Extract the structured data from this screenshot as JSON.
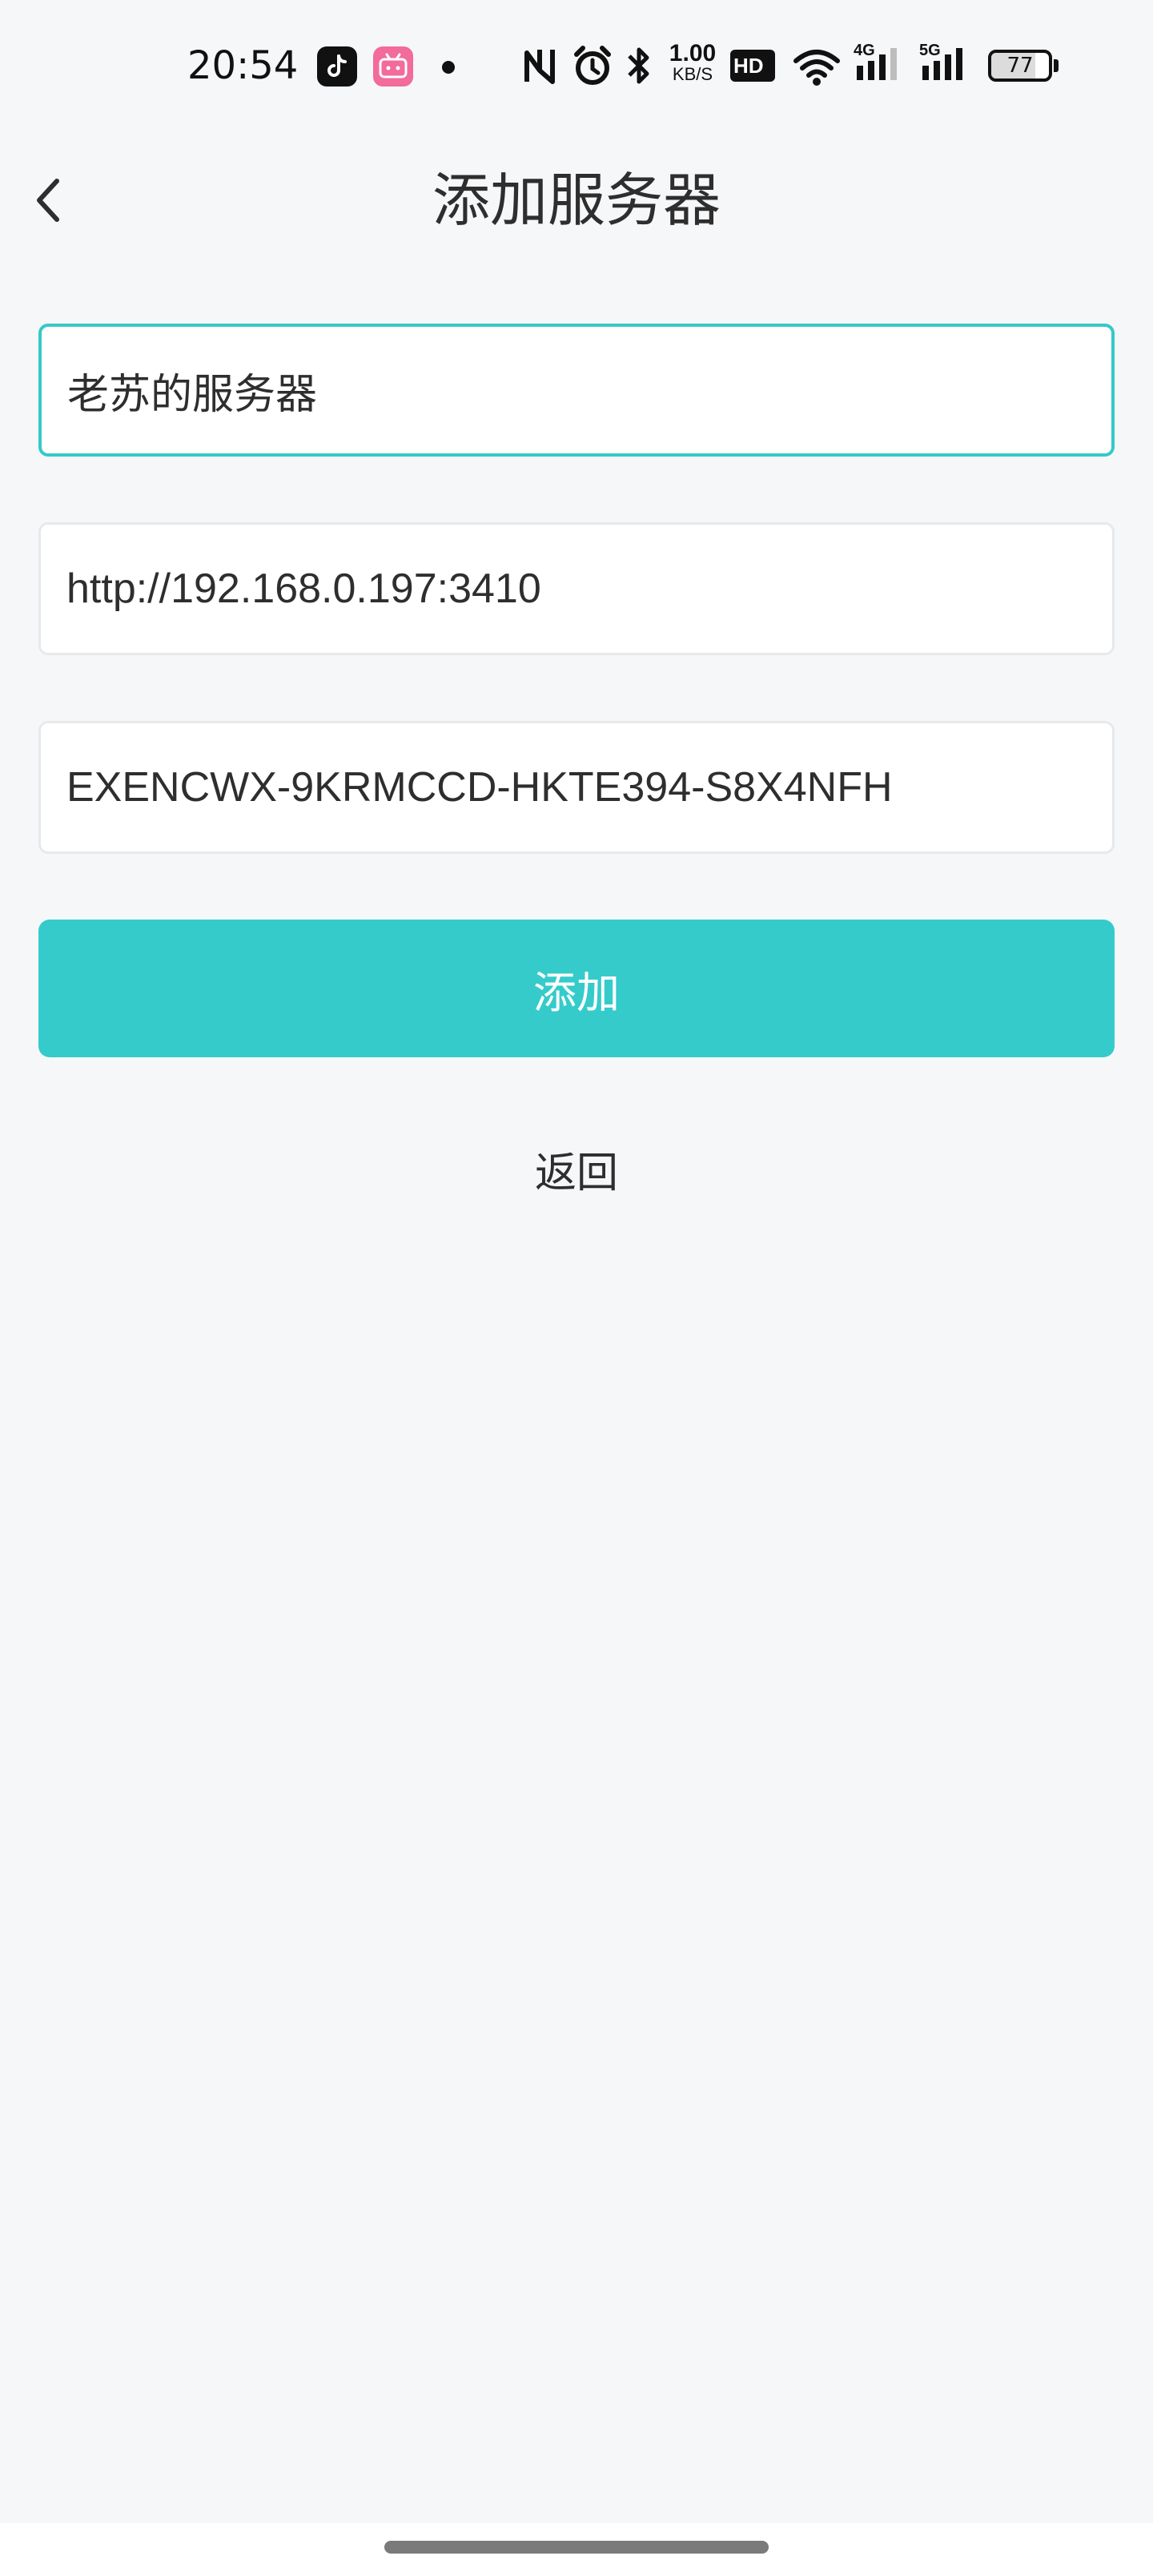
{
  "status_bar": {
    "time": "20:54",
    "network_speed_value": "1.00",
    "network_speed_unit": "KB/S",
    "hd_badge": "HD",
    "signal_1_label": "4G",
    "signal_2_label": "5G",
    "battery_percent": "77",
    "battery_level": 0.77,
    "app_icons": [
      "tiktok-icon",
      "bilibili-icon"
    ],
    "status_icons": [
      "nfc-icon",
      "alarm-icon",
      "bluetooth-icon",
      "hd-icon",
      "wifi-icon",
      "signal-4g-icon",
      "signal-5g-icon",
      "battery-icon"
    ]
  },
  "header": {
    "back_icon": "chevron-left-icon",
    "title": "添加服务器"
  },
  "form": {
    "name_value": "老苏的服务器",
    "url_value": "http://192.168.0.197:3410",
    "key_value": "EXENCWX-9KRMCCD-HKTE394-S8X4NFH"
  },
  "actions": {
    "add_label": "添加",
    "return_label": "返回"
  },
  "colors": {
    "accent": "#35cbcb",
    "focus_border": "#35c9c9",
    "background": "#f6f7f9",
    "field_border": "#e8e9ec",
    "text": "#2e2e2e"
  }
}
